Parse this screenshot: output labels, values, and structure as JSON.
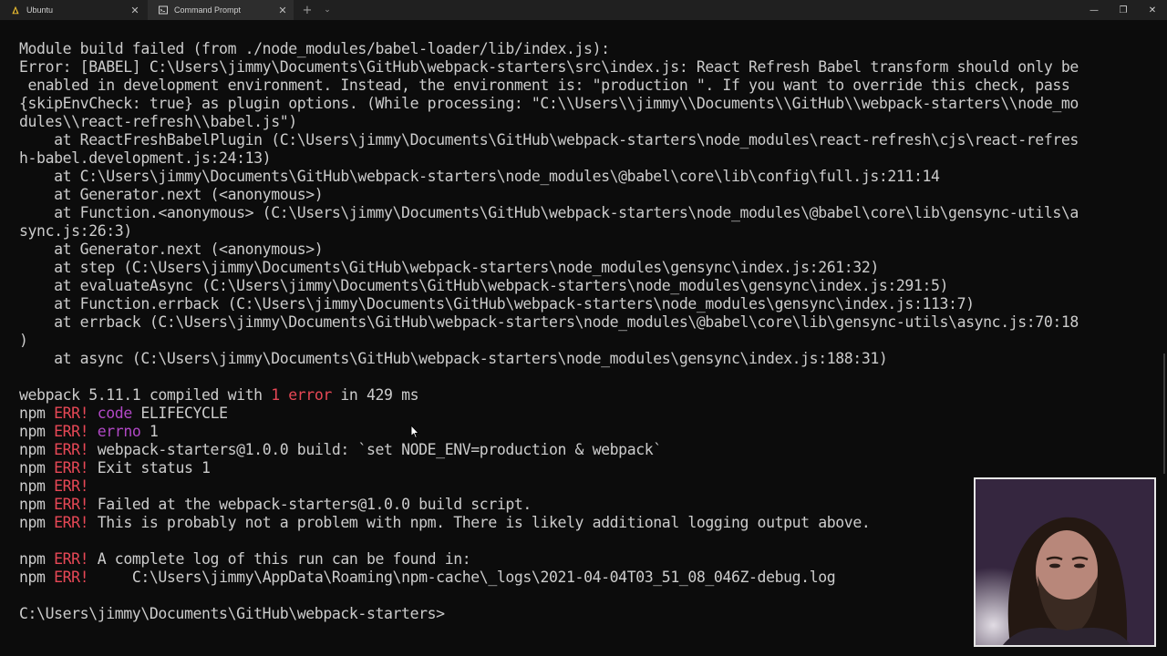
{
  "window": {
    "tabs": [
      {
        "label": "Ubuntu",
        "icon": "linux-penguin-icon",
        "active": false
      },
      {
        "label": "Command Prompt",
        "icon": "cmd-icon",
        "active": true
      }
    ],
    "new_tab_glyph": "+",
    "dropdown_glyph": "⌄",
    "close_glyph": "✕",
    "controls": {
      "minimize": "—",
      "maximize": "❐",
      "close": "✕"
    }
  },
  "terminal": {
    "error_color": "#e74856",
    "keyword_color": "#b148c6",
    "lines": [
      [
        {
          "t": "Module build failed (from ./node_modules/babel-loader/lib/index.js):"
        }
      ],
      [
        {
          "t": "Error: [BABEL] C:\\Users\\jimmy\\Documents\\GitHub\\webpack-starters\\src\\index.js: React Refresh Babel transform should only be"
        }
      ],
      [
        {
          "t": " enabled in development environment. Instead, the environment is: \"production \". If you want to override this check, pass"
        }
      ],
      [
        {
          "t": "{skipEnvCheck: true} as plugin options. (While processing: \"C:\\\\Users\\\\jimmy\\\\Documents\\\\GitHub\\\\webpack-starters\\\\node_mo"
        }
      ],
      [
        {
          "t": "dules\\\\react-refresh\\\\babel.js\")"
        }
      ],
      [
        {
          "t": "    at ReactFreshBabelPlugin (C:\\Users\\jimmy\\Documents\\GitHub\\webpack-starters\\node_modules\\react-refresh\\cjs\\react-refres"
        }
      ],
      [
        {
          "t": "h-babel.development.js:24:13)"
        }
      ],
      [
        {
          "t": "    at C:\\Users\\jimmy\\Documents\\GitHub\\webpack-starters\\node_modules\\@babel\\core\\lib\\config\\full.js:211:14"
        }
      ],
      [
        {
          "t": "    at Generator.next (<anonymous>)"
        }
      ],
      [
        {
          "t": "    at Function.<anonymous> (C:\\Users\\jimmy\\Documents\\GitHub\\webpack-starters\\node_modules\\@babel\\core\\lib\\gensync-utils\\a"
        }
      ],
      [
        {
          "t": "sync.js:26:3)"
        }
      ],
      [
        {
          "t": "    at Generator.next (<anonymous>)"
        }
      ],
      [
        {
          "t": "    at step (C:\\Users\\jimmy\\Documents\\GitHub\\webpack-starters\\node_modules\\gensync\\index.js:261:32)"
        }
      ],
      [
        {
          "t": "    at evaluateAsync (C:\\Users\\jimmy\\Documents\\GitHub\\webpack-starters\\node_modules\\gensync\\index.js:291:5)"
        }
      ],
      [
        {
          "t": "    at Function.errback (C:\\Users\\jimmy\\Documents\\GitHub\\webpack-starters\\node_modules\\gensync\\index.js:113:7)"
        }
      ],
      [
        {
          "t": "    at errback (C:\\Users\\jimmy\\Documents\\GitHub\\webpack-starters\\node_modules\\@babel\\core\\lib\\gensync-utils\\async.js:70:18"
        }
      ],
      [
        {
          "t": ")"
        }
      ],
      [
        {
          "t": "    at async (C:\\Users\\jimmy\\Documents\\GitHub\\webpack-starters\\node_modules\\gensync\\index.js:188:31)"
        }
      ],
      [
        {
          "t": ""
        }
      ],
      [
        {
          "t": "webpack 5.11.1 compiled with "
        },
        {
          "t": "1 error",
          "c": "red"
        },
        {
          "t": " in 429 ms"
        }
      ],
      [
        {
          "t": "npm "
        },
        {
          "t": "ERR!",
          "c": "red"
        },
        {
          "t": " "
        },
        {
          "t": "code",
          "c": "purple"
        },
        {
          "t": " ELIFECYCLE"
        }
      ],
      [
        {
          "t": "npm "
        },
        {
          "t": "ERR!",
          "c": "red"
        },
        {
          "t": " "
        },
        {
          "t": "errno",
          "c": "purple"
        },
        {
          "t": " 1"
        }
      ],
      [
        {
          "t": "npm "
        },
        {
          "t": "ERR!",
          "c": "red"
        },
        {
          "t": " webpack-starters@1.0.0 build: `set NODE_ENV=production & webpack`"
        }
      ],
      [
        {
          "t": "npm "
        },
        {
          "t": "ERR!",
          "c": "red"
        },
        {
          "t": " Exit status 1"
        }
      ],
      [
        {
          "t": "npm "
        },
        {
          "t": "ERR!",
          "c": "red"
        }
      ],
      [
        {
          "t": "npm "
        },
        {
          "t": "ERR!",
          "c": "red"
        },
        {
          "t": " Failed at the webpack-starters@1.0.0 build script."
        }
      ],
      [
        {
          "t": "npm "
        },
        {
          "t": "ERR!",
          "c": "red"
        },
        {
          "t": " This is probably not a problem with npm. There is likely additional logging output above."
        }
      ],
      [
        {
          "t": ""
        }
      ],
      [
        {
          "t": "npm "
        },
        {
          "t": "ERR!",
          "c": "red"
        },
        {
          "t": " A complete log of this run can be found in:"
        }
      ],
      [
        {
          "t": "npm "
        },
        {
          "t": "ERR!",
          "c": "red"
        },
        {
          "t": "     C:\\Users\\jimmy\\AppData\\Roaming\\npm-cache\\_logs\\2021-04-04T03_51_08_046Z-debug.log"
        }
      ],
      [
        {
          "t": ""
        }
      ],
      [
        {
          "t": "C:\\Users\\jimmy\\Documents\\GitHub\\webpack-starters>"
        }
      ]
    ]
  }
}
